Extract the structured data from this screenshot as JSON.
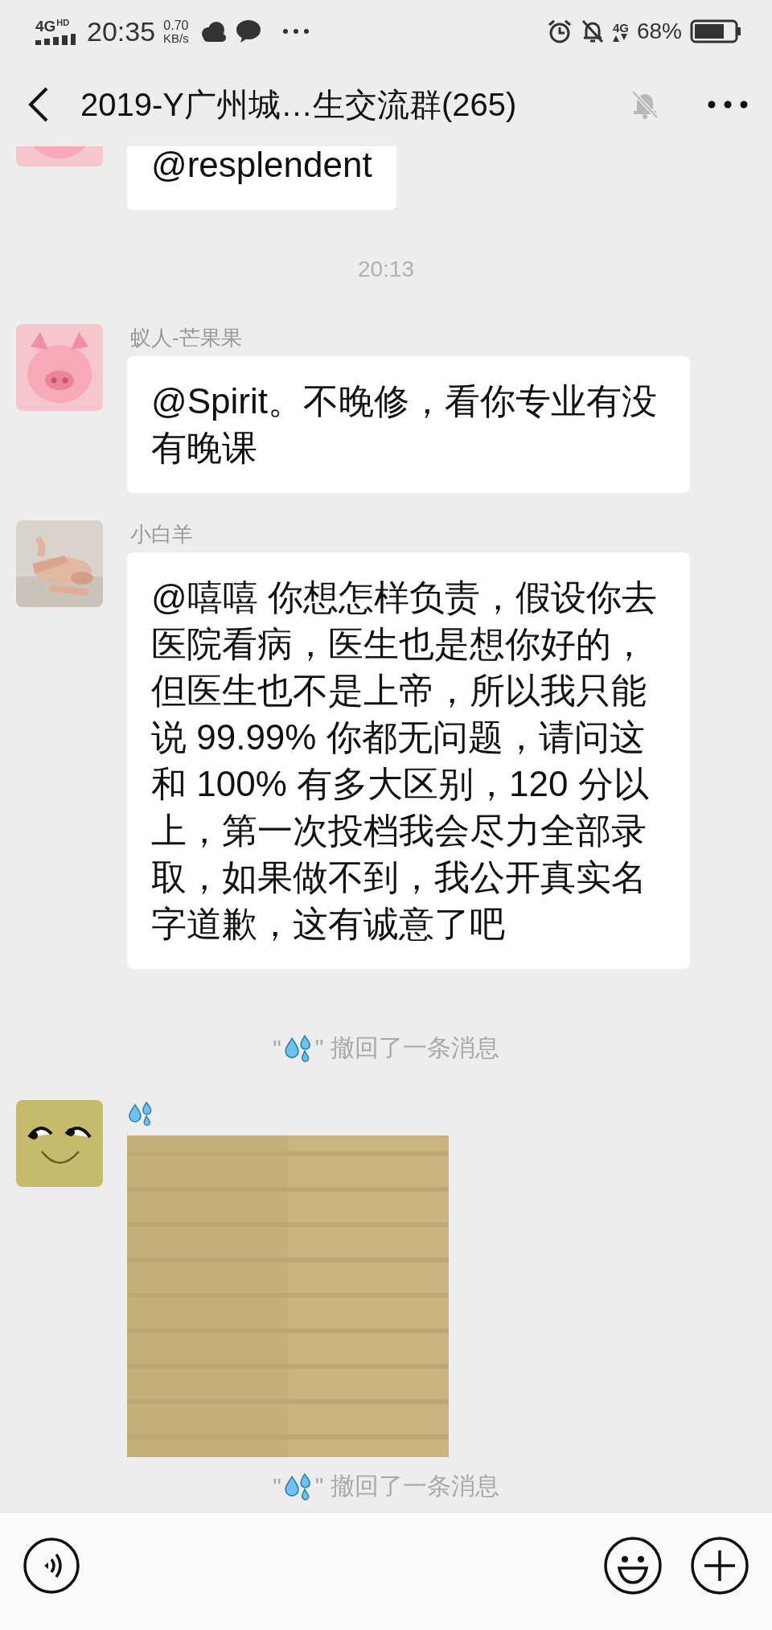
{
  "status_bar": {
    "network": "4G",
    "network_sub": "HD",
    "time": "20:35",
    "speed": "0.70",
    "speed_unit": "KB/s",
    "net_type": "4G",
    "battery": "68%"
  },
  "header": {
    "title": "2019-Y广州城…生交流群(265)",
    "muted": true
  },
  "messages": [
    {
      "kind": "text",
      "cut": true,
      "avatar": {
        "kind": "pig"
      },
      "text": "@resplendent"
    },
    {
      "kind": "time",
      "text": "20:13"
    },
    {
      "kind": "text",
      "avatar": {
        "kind": "pig"
      },
      "name": "蚁人-芒果果",
      "text": "@Spirit。不晚修，看你专业有没有晚课"
    },
    {
      "kind": "text",
      "avatar": {
        "kind": "hands"
      },
      "name": "小白羊",
      "text": "@嘻嘻  你想怎样负责，假设你去医院看病，医生也是想你好的，但医生也不是上帝，所以我只能说 99.99% 你都无问题，请问这和 100% 有多大区别，120 分以上，第一次投档我会尽力全部录取，如果做不到，我公开真实名字道歉，这有诚意了吧"
    },
    {
      "kind": "recall",
      "before": "\"",
      "after": "\" 撤回了一条消息"
    },
    {
      "avatar": {
        "kind": "smiley"
      }
    },
    {
      "kind": "recall",
      "before": "\"",
      "after": "\" 撤回了一条消息"
    }
  ]
}
